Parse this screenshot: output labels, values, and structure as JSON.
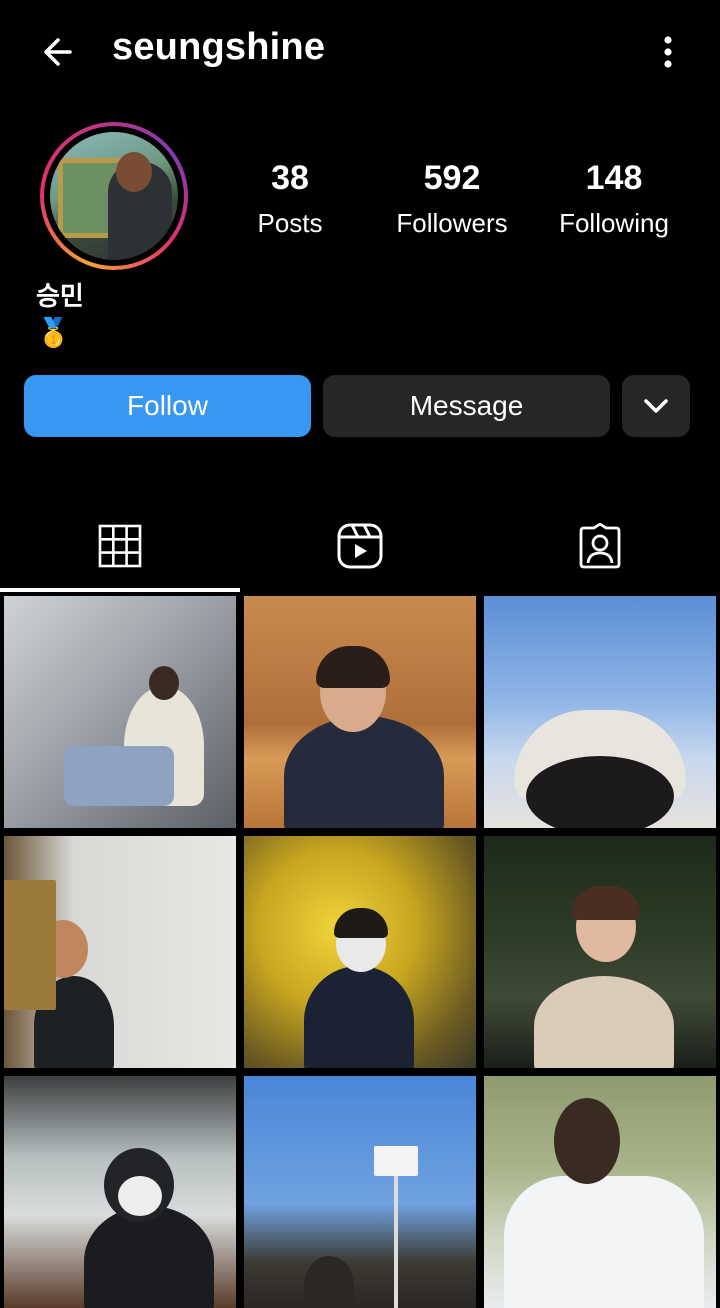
{
  "header": {
    "back_icon": "arrow-left-icon",
    "username": "seungshine",
    "more_icon": "more-vertical-icon"
  },
  "profile": {
    "avatar": "profile-photo-with-story-ring",
    "stats": [
      {
        "value": "38",
        "label": "Posts"
      },
      {
        "value": "592",
        "label": "Followers"
      },
      {
        "value": "148",
        "label": "Following"
      }
    ],
    "display_name": "승민",
    "bio": "🥇"
  },
  "actions": {
    "follow_label": "Follow",
    "message_label": "Message",
    "dropdown_icon": "chevron-down-icon"
  },
  "tabs": [
    {
      "icon": "grid-icon",
      "active": true
    },
    {
      "icon": "reels-icon",
      "active": false
    },
    {
      "icon": "tagged-user-icon",
      "active": false
    }
  ],
  "posts_count_shown": 9,
  "colors": {
    "background": "#000000",
    "follow_button": "#3897f0",
    "secondary_button": "#262626",
    "text": "#ffffff"
  }
}
